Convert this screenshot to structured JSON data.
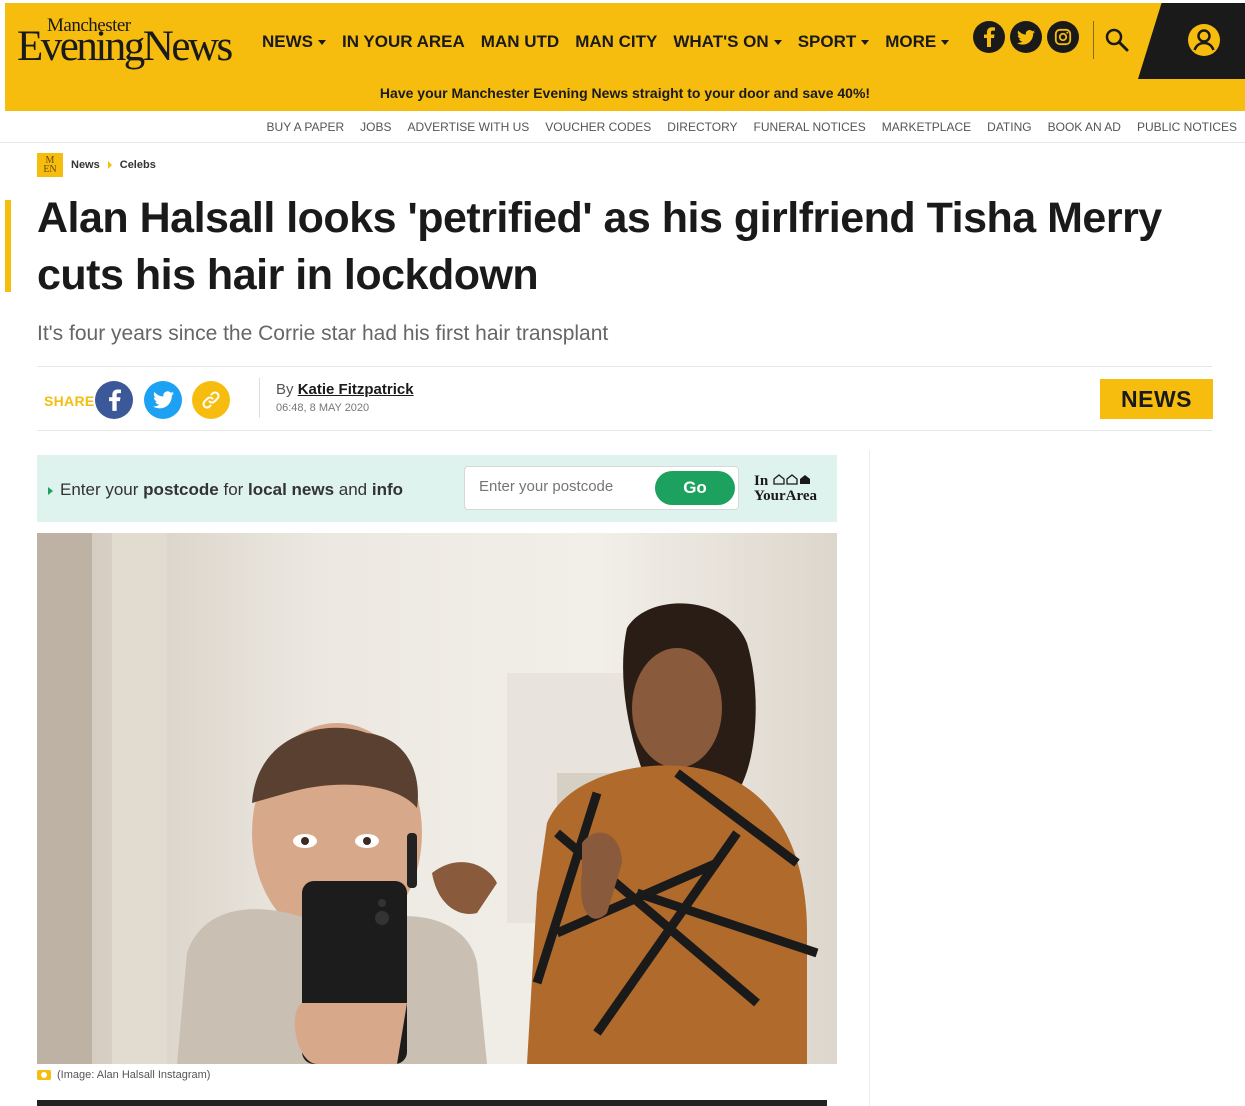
{
  "header": {
    "logo_small": "Manchester",
    "logo_big": "EveningNews",
    "nav": [
      {
        "label": "NEWS",
        "dropdown": true
      },
      {
        "label": "IN YOUR AREA",
        "dropdown": false
      },
      {
        "label": "MAN UTD",
        "dropdown": false
      },
      {
        "label": "MAN CITY",
        "dropdown": false
      },
      {
        "label": "WHAT'S ON",
        "dropdown": true
      },
      {
        "label": "SPORT",
        "dropdown": true
      },
      {
        "label": "MORE",
        "dropdown": true
      }
    ],
    "social": {
      "facebook": "f",
      "twitter": "t",
      "instagram": "ig"
    },
    "promo": "Have your Manchester Evening News straight to your door and save 40%!"
  },
  "subnav": [
    "BUY A PAPER",
    "JOBS",
    "ADVERTISE WITH US",
    "VOUCHER CODES",
    "DIRECTORY",
    "FUNERAL NOTICES",
    "MARKETPLACE",
    "DATING",
    "BOOK AN AD",
    "PUBLIC NOTICES"
  ],
  "breadcrumb": {
    "badge": "M\nEN",
    "items": [
      "News",
      "Celebs"
    ]
  },
  "article": {
    "headline": "Alan Halsall looks 'petrified' as his girlfriend Tisha Merry cuts his hair in lockdown",
    "standfirst": "It's four years since the Corrie star had his first hair transplant",
    "share_label": "SHARE",
    "byline_prefix": "By",
    "author": "Katie Fitzpatrick",
    "timestamp": "06:48, 8 MAY 2020",
    "tag": "NEWS",
    "caption": "(Image: Alan Halsall Instagram)"
  },
  "postcode": {
    "text_pre": "Enter your",
    "text_b1": "postcode",
    "text_mid": "for",
    "text_b2": "local news",
    "text_and": "and",
    "text_b3": "info",
    "placeholder": "Enter your postcode",
    "go_label": "Go",
    "logo_line1": "In",
    "logo_line2": "YourArea"
  },
  "colors": {
    "brand": "#f6bd0f",
    "green": "#1ca25e",
    "facebook": "#3b5998",
    "twitter": "#1da1f2"
  }
}
